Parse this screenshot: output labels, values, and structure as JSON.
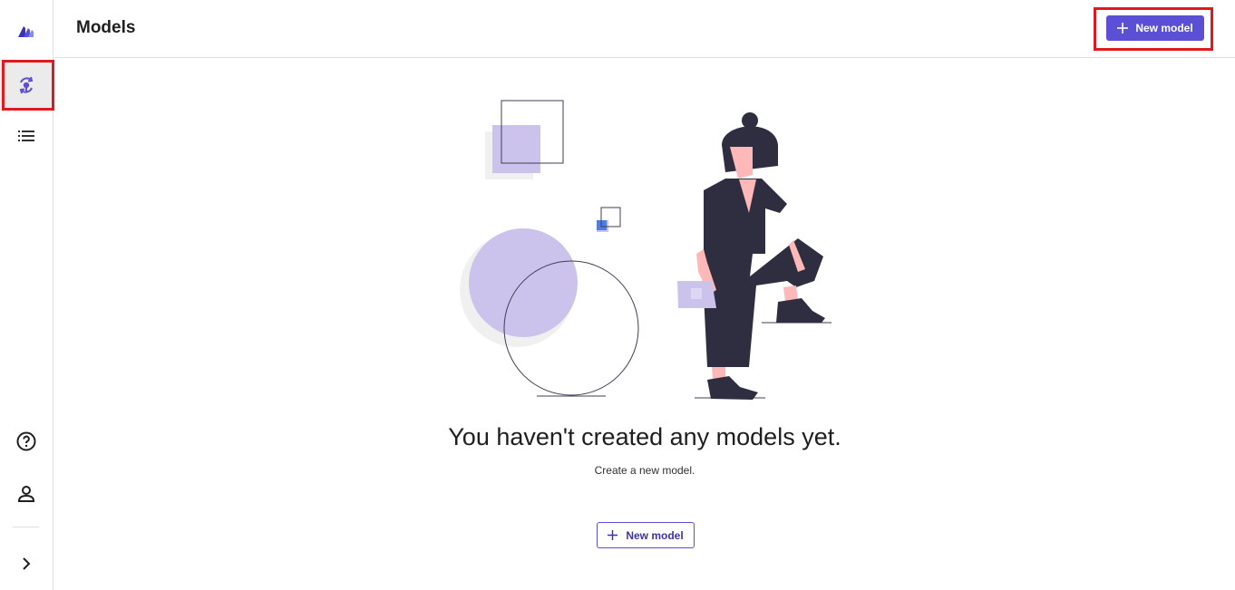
{
  "app": {
    "logo_icon": "app-logo-icon",
    "accent_color": "#5b4fd6"
  },
  "sidebar": {
    "items": [
      {
        "name": "models",
        "icon": "models-icon",
        "active": true
      },
      {
        "name": "list",
        "icon": "list-icon",
        "active": false
      }
    ],
    "bottom": [
      {
        "name": "help",
        "icon": "help-icon"
      },
      {
        "name": "account",
        "icon": "user-icon"
      },
      {
        "name": "expand",
        "icon": "chevron-right-icon"
      }
    ]
  },
  "header": {
    "title": "Models",
    "new_model_label": "New model"
  },
  "empty_state": {
    "title": "You haven't created any models yet.",
    "subtitle": "Create a new model.",
    "button_label": "New model"
  }
}
